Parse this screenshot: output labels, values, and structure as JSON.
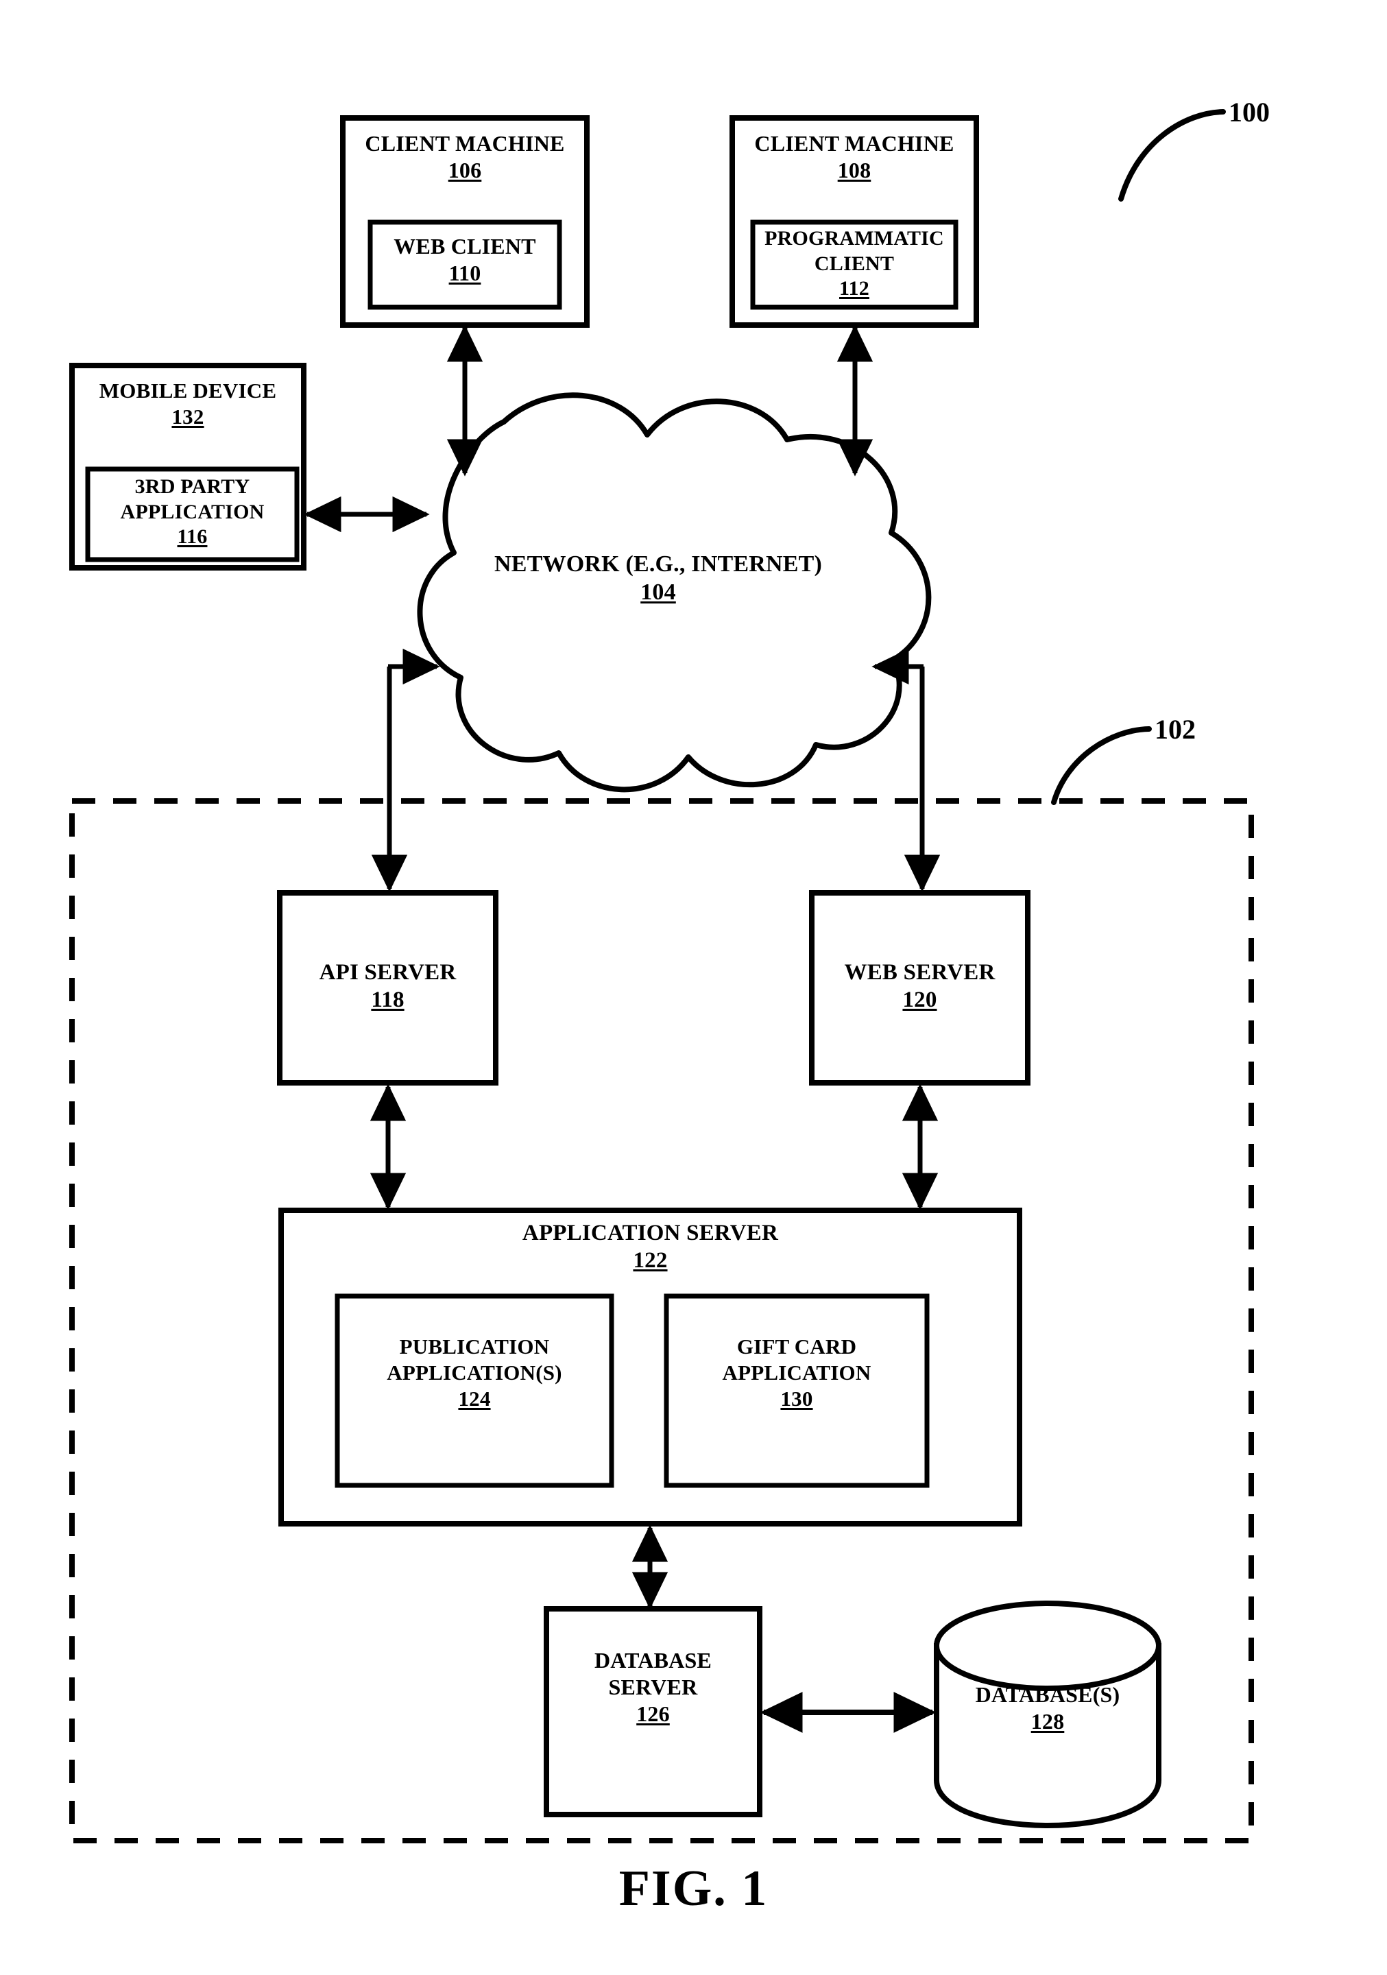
{
  "figure": {
    "caption": "FIG. 1",
    "system_ref": "100",
    "networked_system_ref": "102"
  },
  "nodes": {
    "client_machine_1": {
      "title": "CLIENT MACHINE",
      "ref": "106",
      "child": {
        "title": "WEB CLIENT",
        "ref": "110"
      }
    },
    "client_machine_2": {
      "title": "CLIENT MACHINE",
      "ref": "108",
      "child": {
        "title_line1": "PROGRAMMATIC",
        "title_line2": "CLIENT",
        "ref": "112"
      }
    },
    "mobile_device": {
      "title": "MOBILE DEVICE",
      "ref": "132",
      "child": {
        "title_line1": "3RD PARTY",
        "title_line2": "APPLICATION",
        "ref": "116"
      }
    },
    "network": {
      "title": "NETWORK (E.G., INTERNET)",
      "ref": "104"
    },
    "api_server": {
      "title": "API SERVER",
      "ref": "118"
    },
    "web_server": {
      "title": "WEB SERVER",
      "ref": "120"
    },
    "application_server": {
      "title": "APPLICATION SERVER",
      "ref": "122",
      "children": [
        {
          "title_line1": "PUBLICATION",
          "title_line2": "APPLICATION(S)",
          "ref": "124"
        },
        {
          "title_line1": "GIFT CARD",
          "title_line2": "APPLICATION",
          "ref": "130"
        }
      ]
    },
    "database_server": {
      "title_line1": "DATABASE",
      "title_line2": "SERVER",
      "ref": "126"
    },
    "databases": {
      "title": "DATABASE(S)",
      "ref": "128"
    }
  },
  "colors": {
    "stroke": "#000000",
    "background": "#ffffff"
  }
}
